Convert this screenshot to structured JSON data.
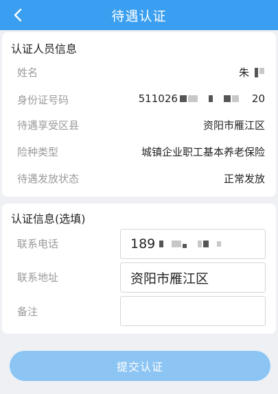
{
  "header": {
    "title": "待遇认证"
  },
  "personal": {
    "section_title": "认证人员信息",
    "rows": [
      {
        "label": "姓名",
        "value": "朱"
      },
      {
        "label": "身份证号码",
        "value_prefix": "511026",
        "value_suffix": "20"
      },
      {
        "label": "待遇享受区县",
        "value": "资阳市雁江区"
      },
      {
        "label": "险种类型",
        "value": "城镇企业职工基本养老保险"
      },
      {
        "label": "待遇发放状态",
        "value": "正常发放"
      }
    ]
  },
  "auth": {
    "section_title": "认证信息(选填)",
    "phone": {
      "label": "联系电话",
      "value_prefix": "189"
    },
    "address": {
      "label": "联系地址",
      "value": "资阳市雁江区"
    },
    "remark": {
      "label": "备注",
      "value": ""
    }
  },
  "submit_label": "提交认证",
  "colors": {
    "header": "#3a9ff0",
    "button": "#8cc4f3"
  },
  "icons": {
    "back": "chevron-left-icon"
  }
}
